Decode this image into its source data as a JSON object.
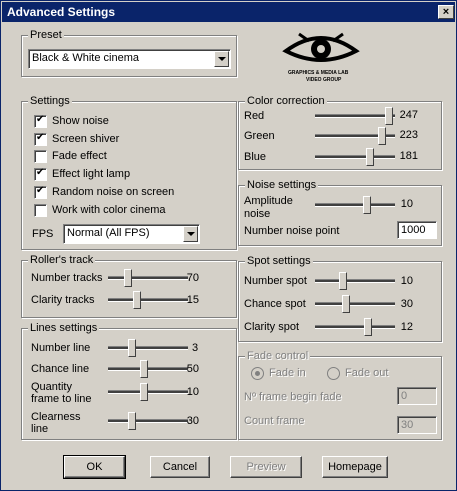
{
  "window": {
    "title": "Advanced Settings",
    "close_glyph": "×"
  },
  "preset": {
    "legend": "Preset",
    "value": "Black & White cinema"
  },
  "logo": {
    "line1": "GRAPHICS & MEDIA LAB",
    "line2": "VIDEO GROUP"
  },
  "settings": {
    "legend": "Settings",
    "items": [
      {
        "label": "Show noise",
        "checked": true
      },
      {
        "label": "Screen shiver",
        "checked": true
      },
      {
        "label": "Fade effect",
        "checked": false
      },
      {
        "label": "Effect light lamp",
        "checked": true
      },
      {
        "label": "Random noise on screen",
        "checked": true
      },
      {
        "label": "Work with color cinema",
        "checked": false
      }
    ],
    "fps_label": "FPS",
    "fps_value": "Normal (All FPS)"
  },
  "color_correction": {
    "legend": "Color correction",
    "rows": [
      {
        "label": "Red",
        "value": "247",
        "level": 0.97
      },
      {
        "label": "Green",
        "value": "223",
        "level": 0.87
      },
      {
        "label": "Blue",
        "value": "181",
        "level": 0.71
      }
    ]
  },
  "noise_settings": {
    "legend": "Noise settings",
    "amplitude_label": "Amplitude noise",
    "amplitude_value": "10",
    "amplitude_level": 0.66,
    "number_point_label": "Number noise point",
    "number_point_value": "1000"
  },
  "rollers_track": {
    "legend": "Roller's track",
    "rows": [
      {
        "label": "Number tracks",
        "value": "70",
        "level": 0.22
      },
      {
        "label": "Clarity tracks",
        "value": "15",
        "level": 0.35
      }
    ]
  },
  "spot_settings": {
    "legend": "Spot settings",
    "rows": [
      {
        "label": "Number spot",
        "value": "10",
        "level": 0.33
      },
      {
        "label": "Chance spot",
        "value": "30",
        "level": 0.38
      },
      {
        "label": "Clarity spot",
        "value": "12",
        "level": 0.68
      }
    ]
  },
  "lines_settings": {
    "legend": "Lines settings",
    "rows": [
      {
        "label": "Number line",
        "value": "3",
        "level": 0.28
      },
      {
        "label": "Chance line",
        "value": "50",
        "level": 0.45
      },
      {
        "label": "Quantity frame to line",
        "value": "10",
        "level": 0.45
      },
      {
        "label": "Clearness line",
        "value": "30",
        "level": 0.28
      }
    ]
  },
  "fade_control": {
    "legend": "Fade control",
    "fade_in": "Fade in",
    "fade_out": "Fade out",
    "begin_label": "Nº frame begin fade",
    "begin_value": "0",
    "count_label": "Count frame",
    "count_value": "30"
  },
  "buttons": {
    "ok": "OK",
    "cancel": "Cancel",
    "preview": "Preview",
    "homepage": "Homepage"
  }
}
